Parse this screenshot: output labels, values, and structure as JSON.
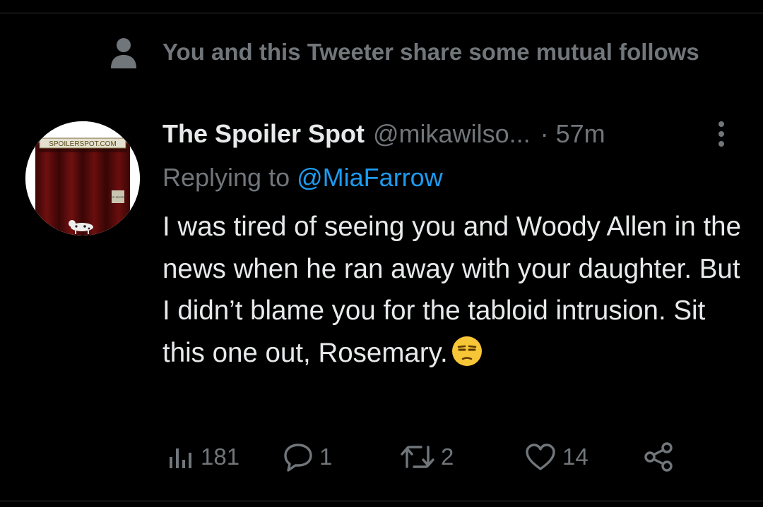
{
  "social_context": {
    "text": "You and this Tweeter share some mutual follows",
    "icon": "person-icon"
  },
  "tweet": {
    "avatar": {
      "sign_text": "SPOILERSPOT.COM",
      "placard_text": "TOP SECRET"
    },
    "display_name": "The Spoiler Spot",
    "handle": "@mikawilso...",
    "separator": "·",
    "time": "57m",
    "more_icon": "more-vertical-icon",
    "reply_prefix": "Replying to",
    "reply_to": "@MiaFarrow",
    "text": "I was tired of seeing you and Woody Allen in the news when he ran away with your daughter. But I didn’t blame you for the tabloid intrusion. Sit this one out, Rosemary.",
    "emoji": "unamused-face-emoji"
  },
  "actions": {
    "views": {
      "icon": "views-icon",
      "count": "181"
    },
    "reply": {
      "icon": "reply-icon",
      "count": "1"
    },
    "retweet": {
      "icon": "retweet-icon",
      "count": "2"
    },
    "like": {
      "icon": "heart-icon",
      "count": "14"
    },
    "share": {
      "icon": "share-icon"
    }
  },
  "colors": {
    "background": "#000000",
    "text_primary": "#e7e9ea",
    "text_secondary": "#71767b",
    "link": "#1d9bf0",
    "divider": "#2f3336"
  }
}
